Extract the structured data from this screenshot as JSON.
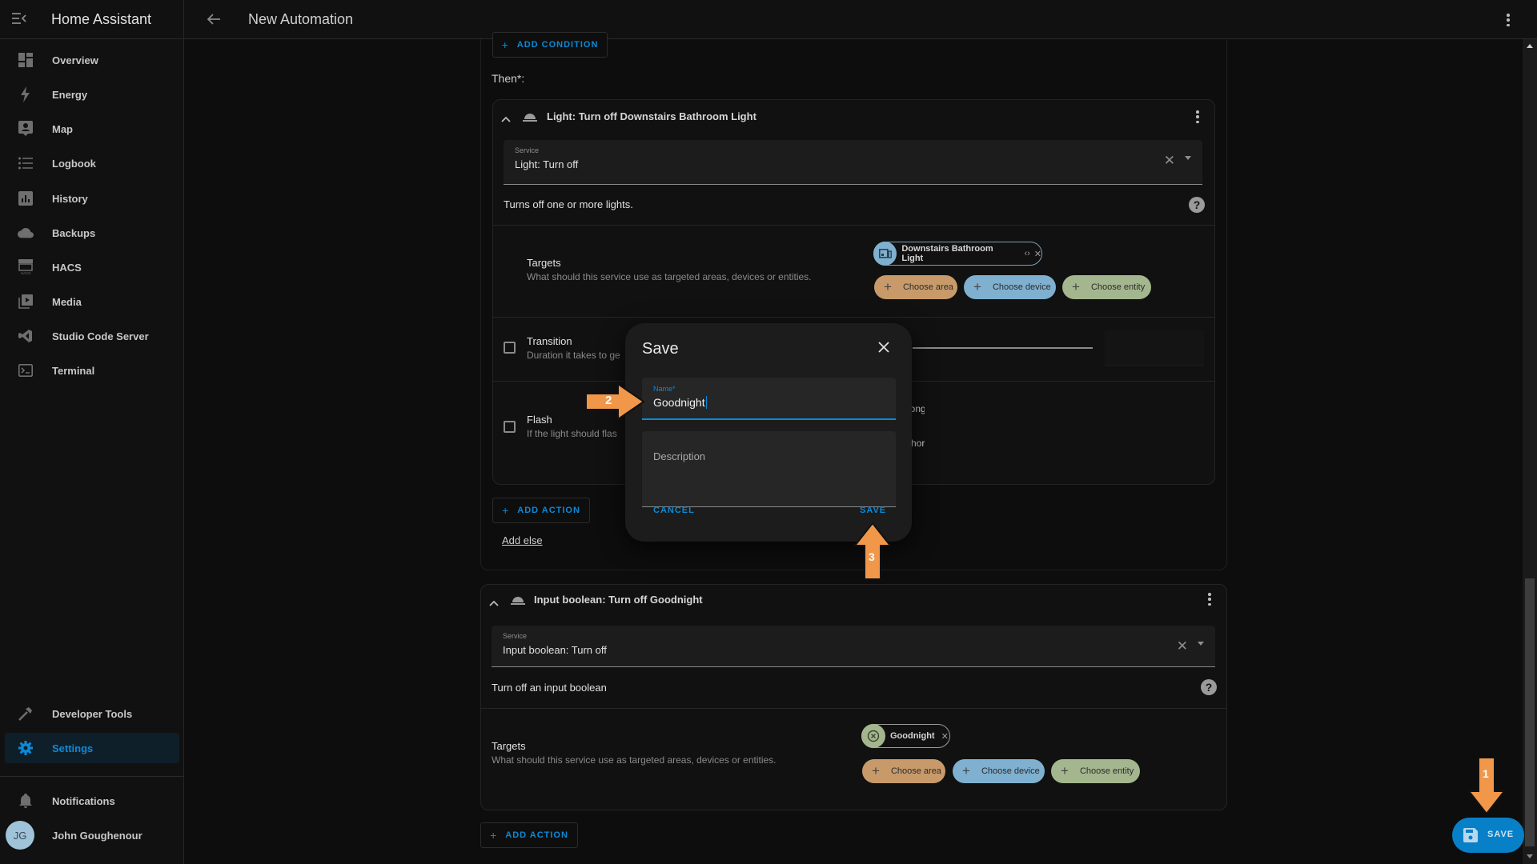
{
  "app": {
    "title": "Home Assistant",
    "page_title": "New Automation"
  },
  "sidebar": {
    "items": [
      {
        "label": "Overview",
        "icon": "view-dashboard-icon"
      },
      {
        "label": "Energy",
        "icon": "lightning-bolt-icon"
      },
      {
        "label": "Map",
        "icon": "map-person-icon"
      },
      {
        "label": "Logbook",
        "icon": "list-icon"
      },
      {
        "label": "History",
        "icon": "chart-box-icon"
      },
      {
        "label": "Backups",
        "icon": "cloud-icon"
      },
      {
        "label": "HACS",
        "icon": "hacs-store-icon"
      },
      {
        "label": "Media",
        "icon": "play-box-multiple-icon"
      },
      {
        "label": "Studio Code Server",
        "icon": "vscode-icon"
      },
      {
        "label": "Terminal",
        "icon": "console-icon"
      }
    ],
    "bottom_items": [
      {
        "label": "Developer Tools",
        "icon": "hammer-icon"
      },
      {
        "label": "Settings",
        "icon": "cog-icon",
        "active": true
      }
    ],
    "notifications_label": "Notifications",
    "user": {
      "name": "John Goughenour",
      "initials": "JG"
    }
  },
  "editor": {
    "add_condition_label": "ADD CONDITION",
    "then_label": "Then*:",
    "actions": [
      {
        "title": "Light: Turn off Downstairs Bathroom Light",
        "service_label": "Service",
        "service_value": "Light: Turn off",
        "description": "Turns off one or more lights.",
        "targets_title": "Targets",
        "targets_desc": "What should this service use as targeted areas, devices or entities.",
        "target_chip": "Downstairs Bathroom Light",
        "choose_area": "Choose area",
        "choose_device": "Choose device",
        "choose_entity": "Choose entity",
        "transition_title": "Transition",
        "transition_desc": "Duration it takes to ge",
        "flash_title": "Flash",
        "flash_desc": "If the light should flas",
        "flash_option_long": "Long",
        "flash_option_short": "Short"
      },
      {
        "title": "Input boolean: Turn off Goodnight",
        "service_label": "Service",
        "service_value": "Input boolean: Turn off",
        "description": "Turn off an input boolean",
        "targets_title": "Targets",
        "targets_desc": "What should this service use as targeted areas, devices or entities.",
        "target_chip": "Goodnight",
        "choose_area": "Choose area",
        "choose_device": "Choose device",
        "choose_entity": "Choose entity"
      }
    ],
    "add_action_label": "ADD ACTION",
    "add_else_label": "Add else"
  },
  "dialog": {
    "title": "Save",
    "name_label": "Name*",
    "name_value": "Goodnight",
    "description_placeholder": "Description",
    "cancel_label": "CANCEL",
    "save_label": "SAVE"
  },
  "fab": {
    "save_label": "SAVE"
  },
  "annotations": {
    "step1": "1",
    "step2": "2",
    "step3": "3",
    "color": "#f0974a"
  },
  "colors": {
    "accent": "#0b8ad8",
    "area_chip": "#c89a6a",
    "device_chip": "#7fb0cf",
    "entity_chip": "#a4b68e"
  }
}
